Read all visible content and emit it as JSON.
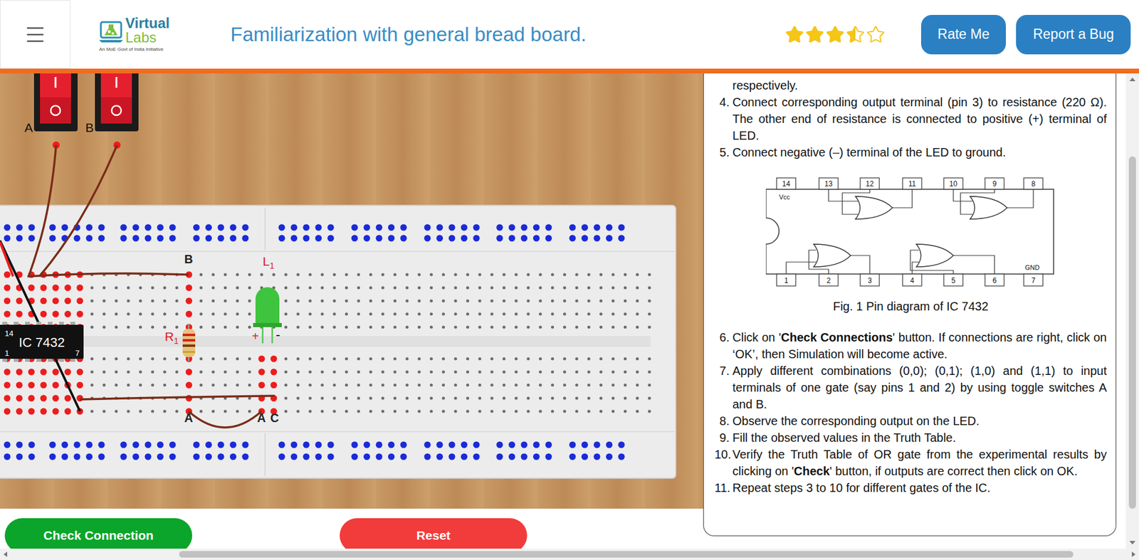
{
  "header": {
    "logo": {
      "word1": "Virtual",
      "word2": "Labs",
      "tagline": "An MoE Govt of India Initiative"
    },
    "title": "Familiarization with general bread board.",
    "rating": {
      "stars": 3.5,
      "max": 5
    },
    "buttons": [
      "Rate Me",
      "Report a Bug"
    ]
  },
  "simulator": {
    "switches": [
      {
        "label": "A",
        "on": false
      },
      {
        "label": "B",
        "on": false
      }
    ],
    "ic": {
      "label": "IC 7432",
      "pin_top_left": "14",
      "pin_bottom_left": "1",
      "pin_bottom_right": "7"
    },
    "resistor": {
      "label": "R",
      "sub": "1"
    },
    "led": {
      "label": "L",
      "sub": "1",
      "plus": "+",
      "minus": "-",
      "lit": false
    },
    "points": [
      {
        "label": "B"
      },
      {
        "label": "A"
      },
      {
        "label": "A"
      },
      {
        "label": "C"
      }
    ],
    "occupied": {
      "top_columns": [
        0,
        1,
        2,
        3,
        4,
        5,
        6,
        15
      ],
      "bottom_columns": [
        0,
        1,
        2,
        3,
        4,
        5,
        6,
        15,
        21,
        22
      ]
    },
    "buttons": [
      {
        "label": "Check Connection",
        "color": "#0aa52a"
      },
      {
        "label": "Reset",
        "color": "#f23b3b"
      }
    ]
  },
  "instructions": {
    "lead": "respectively.",
    "steps": [
      {
        "num": "4.",
        "parts": [
          {
            "text": "Connect corresponding output terminal (pin 3) to resistance (220 Ω). The other end of resistance is connected to positive (+) terminal of LED.",
            "bold": false
          }
        ]
      },
      {
        "num": "5.",
        "parts": [
          {
            "text": "Connect negative (–) terminal of the LED to ground.",
            "bold": false
          }
        ]
      }
    ],
    "figure": {
      "top_pins": [
        "14",
        "13",
        "12",
        "11",
        "10",
        "9",
        "8"
      ],
      "bottom_pins": [
        "1",
        "2",
        "3",
        "4",
        "5",
        "6",
        "7"
      ],
      "vcc": "Vcc",
      "gnd": "GND",
      "caption": "Fig. 1 Pin diagram of IC 7432"
    },
    "steps_after_figure": [
      {
        "num": "6.",
        "parts": [
          {
            "text": "Click on '",
            "bold": false
          },
          {
            "text": "Check Connections",
            "bold": true
          },
          {
            "text": "' button. If connections are right, click on ‘OK’, then Simulation will become active.",
            "bold": false
          }
        ]
      },
      {
        "num": "7.",
        "parts": [
          {
            "text": "Apply different combinations (0,0); (0,1); (1,0) and (1,1) to input terminals of one gate (say pins 1 and 2) by using toggle switches A and B.",
            "bold": false
          }
        ]
      },
      {
        "num": "8.",
        "parts": [
          {
            "text": "Observe the corresponding output on the LED.",
            "bold": false
          }
        ]
      },
      {
        "num": "9.",
        "parts": [
          {
            "text": "Fill the observed values in the Truth Table.",
            "bold": false
          }
        ]
      },
      {
        "num": "10.",
        "parts": [
          {
            "text": "Verify the Truth Table of OR gate from the experimental results by clicking on '",
            "bold": false
          },
          {
            "text": "Check",
            "bold": true
          },
          {
            "text": "' button, if outputs are correct then click on OK.",
            "bold": false
          }
        ]
      },
      {
        "num": "11.",
        "parts": [
          {
            "text": "Repeat steps 3 to 10 for different gates of the IC.",
            "bold": false
          }
        ]
      }
    ]
  }
}
